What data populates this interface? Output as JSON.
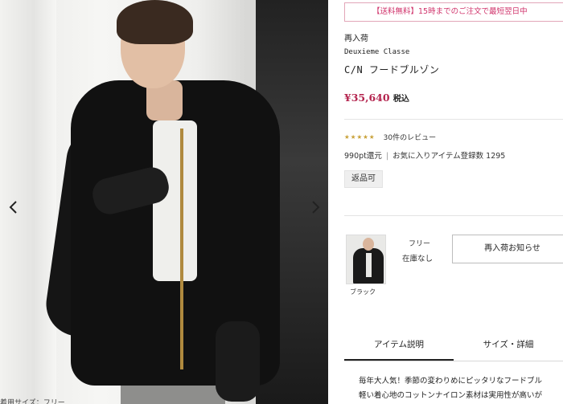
{
  "gallery": {
    "prev_icon": "chevron-left-icon",
    "next_icon": "chevron-right-icon",
    "caption": "着用サイズ：フリー"
  },
  "shipping": {
    "banner_tag": "【送料無料】",
    "banner_text": "15時までのご注文で最短翌日中"
  },
  "product": {
    "restock_tag": "再入荷",
    "brand": "Deuxieme Classe",
    "name": "C/N フードブルゾン",
    "price": "¥35,640",
    "tax_label": "税込",
    "rating_stars": "★★★★★",
    "review_count": "30件のレビュー",
    "points": "990pt還元",
    "favorites": "お気に入りアイテム登録数 1295",
    "return_badge": "返品可"
  },
  "variant": {
    "color": "ブラック",
    "size": "フリー",
    "stock": "在庫なし",
    "restock_button": "再入荷お知らせ"
  },
  "tabs": [
    {
      "label": "アイテム説明",
      "active": true
    },
    {
      "label": "サイズ・詳細",
      "active": false
    }
  ],
  "description": {
    "line1": "毎年大人気！季節の変わりめにピッタリなフードブル",
    "line2": "軽い着心地のコットンナイロン素材は実用性が高いが"
  },
  "colors": {
    "accent_pink": "#d0336b",
    "price_red": "#b4254f"
  }
}
